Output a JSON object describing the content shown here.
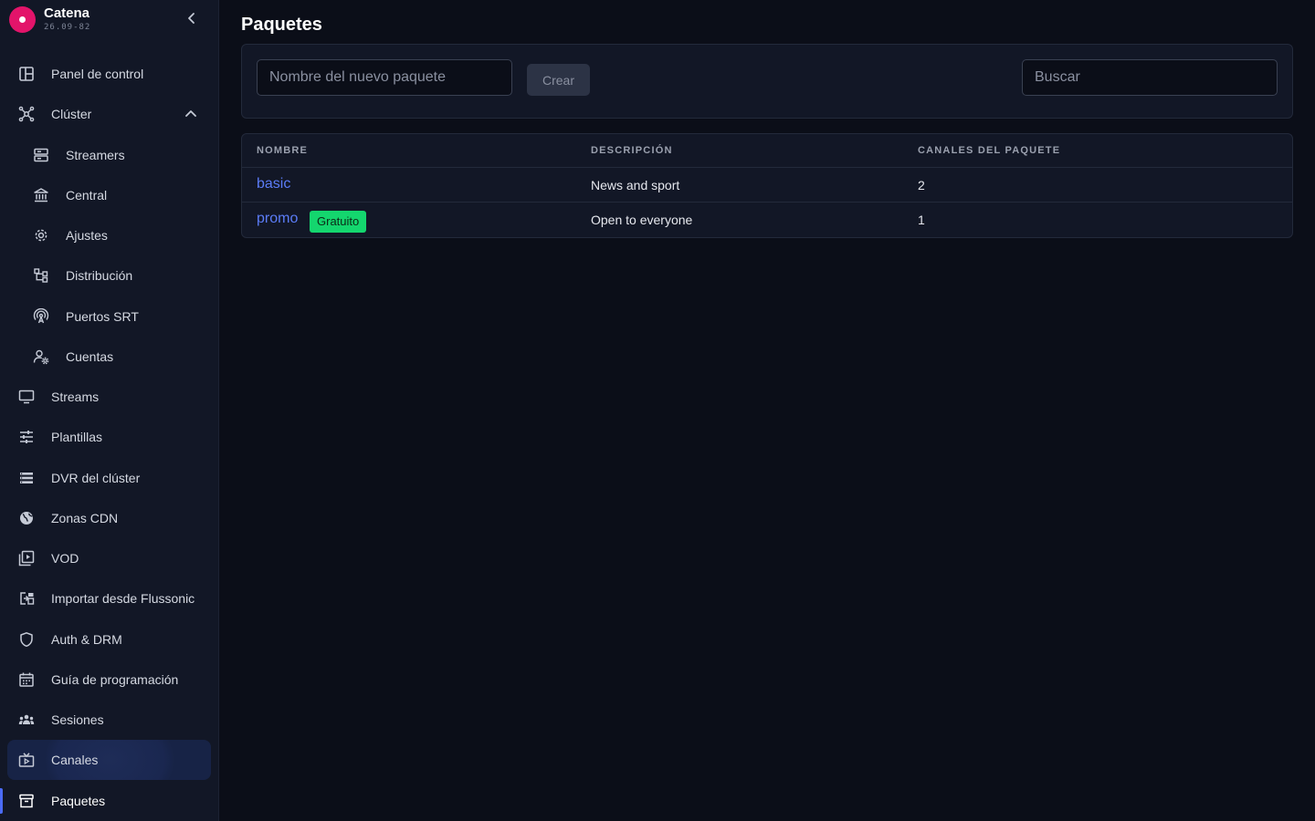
{
  "app": {
    "name": "Catena",
    "version": "26.09-82"
  },
  "sidebar": {
    "items": [
      {
        "label": "Panel de control",
        "icon": "dashboard-icon"
      },
      {
        "label": "Clúster",
        "icon": "cluster-icon"
      },
      {
        "label": "Streamers",
        "icon": "server-icon"
      },
      {
        "label": "Central",
        "icon": "bank-icon"
      },
      {
        "label": "Ajustes",
        "icon": "gear-icon"
      },
      {
        "label": "Distribución",
        "icon": "hierarchy-icon"
      },
      {
        "label": "Puertos SRT",
        "icon": "antenna-icon"
      },
      {
        "label": "Cuentas",
        "icon": "user-gear-icon"
      },
      {
        "label": "Streams",
        "icon": "monitor-icon"
      },
      {
        "label": "Plantillas",
        "icon": "sliders-icon"
      },
      {
        "label": "DVR del clúster",
        "icon": "list-icon"
      },
      {
        "label": "Zonas CDN",
        "icon": "globe-icon"
      },
      {
        "label": "VOD",
        "icon": "video-library-icon"
      },
      {
        "label": "Importar desde Flussonic",
        "icon": "import-icon"
      },
      {
        "label": "Auth & DRM",
        "icon": "shield-icon"
      },
      {
        "label": "Guía de programación",
        "icon": "calendar-icon"
      },
      {
        "label": "Sesiones",
        "icon": "group-icon"
      },
      {
        "label": "Canales",
        "icon": "tv-icon"
      },
      {
        "label": "Paquetes",
        "icon": "archive-icon"
      }
    ]
  },
  "main": {
    "title": "Paquetes",
    "new_package_placeholder": "Nombre del nuevo paquete",
    "create_label": "Crear",
    "search_placeholder": "Buscar",
    "table": {
      "columns": [
        "NOMBRE",
        "DESCRIPCIÓN",
        "CANALES DEL PAQUETE"
      ],
      "rows": [
        {
          "name": "basic",
          "badge": "",
          "description": "News and sport",
          "channels": "2"
        },
        {
          "name": "promo",
          "badge": "Gratuito",
          "description": "Open to everyone",
          "channels": "1"
        }
      ]
    }
  },
  "colors": {
    "accent": "#4b6bf5",
    "link": "#5b7cf7",
    "badge": "#14d66e",
    "brand": "#e3146a"
  }
}
